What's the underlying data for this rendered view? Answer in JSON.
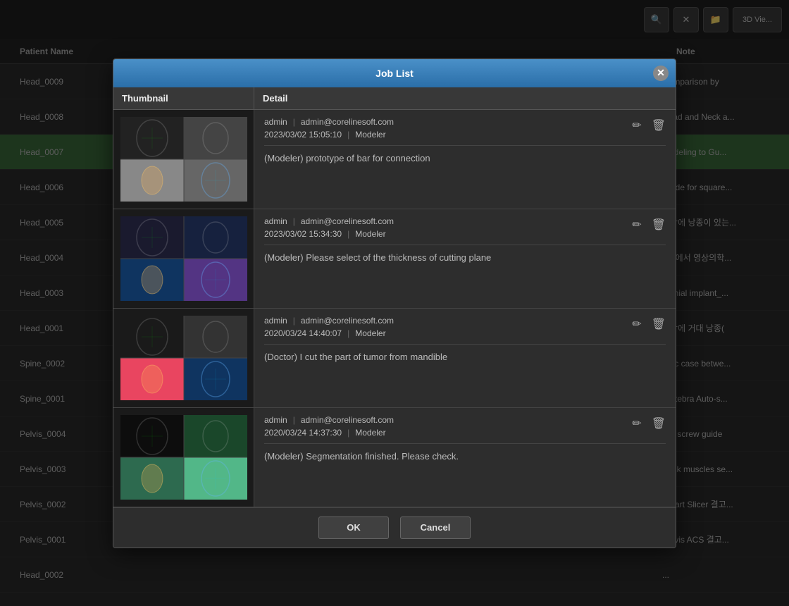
{
  "app": {
    "title": "Job List"
  },
  "toolbar": {
    "search_icon": "🔍",
    "close_icon": "✕",
    "folder_icon": "📁",
    "view_label": "3D Vie..."
  },
  "table": {
    "col_patient": "Patient Name",
    "col_note": "Note",
    "rows": [
      {
        "id": "row-head-0009",
        "patient": "Head_0009",
        "note": "Comparison by",
        "selected": false
      },
      {
        "id": "row-head-0008",
        "patient": "Head_0008",
        "note": "Head and Neck a...",
        "selected": false
      },
      {
        "id": "row-head-0007",
        "patient": "Head_0007",
        "note": "Modeling to Gu...",
        "selected": true
      },
      {
        "id": "row-head-0006",
        "patient": "Head_0006",
        "note": "Guide for square...",
        "selected": false
      },
      {
        "id": "row-head-0005",
        "patient": "Head_0005",
        "note": "상악에 낭종이 있는...",
        "selected": false
      },
      {
        "id": "row-head-0004",
        "patient": "Head_0004",
        "note": "MR에서 영상의학...",
        "selected": false
      },
      {
        "id": "row-head-0003",
        "patient": "Head_0003",
        "note": "cranial implant_...",
        "selected": false
      },
      {
        "id": "row-head-0001",
        "patient": "Head_0001",
        "note": "하악에 거대 낭종(",
        "selected": false
      },
      {
        "id": "row-spine-0002",
        "patient": "Spine_0002",
        "note": "Disc case betwe...",
        "selected": false
      },
      {
        "id": "row-spine-0001",
        "patient": "Spine_0001",
        "note": "Vertebra Auto-s...",
        "selected": false
      },
      {
        "id": "row-pelvis-0004",
        "patient": "Pelvis_0004",
        "note": "Hip screw guide",
        "selected": false
      },
      {
        "id": "row-pelvis-0003",
        "patient": "Pelvis_0003",
        "note": "Back muscles se...",
        "selected": false
      },
      {
        "id": "row-pelvis-0002",
        "patient": "Pelvis_0002",
        "note": "Smart Slicer 결고...",
        "selected": false
      },
      {
        "id": "row-pelvis-0001",
        "patient": "Pelvis_0001",
        "note": "Pelvis ACS 결고...",
        "selected": false
      },
      {
        "id": "row-head-0002",
        "patient": "Head_0002",
        "note": "...",
        "selected": false
      }
    ]
  },
  "modal": {
    "title": "Job List",
    "col_thumbnail": "Thumbnail",
    "col_detail": "Detail",
    "jobs": [
      {
        "id": "job-1",
        "user": "admin",
        "email": "admin@corelinesoft.com",
        "datetime": "2023/03/02 15:05:10",
        "role": "Modeler",
        "message": "(Modeler) prototype of bar for connection",
        "has_actions": true
      },
      {
        "id": "job-2",
        "user": "admin",
        "email": "admin@corelinesoft.com",
        "datetime": "2023/03/02 15:34:30",
        "role": "Modeler",
        "message": "(Modeler) Please select of the thickness of cutting plane",
        "has_actions": true
      },
      {
        "id": "job-3",
        "user": "admin",
        "email": "admin@corelinesoft.com",
        "datetime": "2020/03/24 14:40:07",
        "role": "Modeler",
        "message": "(Doctor) I cut the part of tumor from mandible",
        "has_actions": true
      },
      {
        "id": "job-4",
        "user": "admin",
        "email": "admin@corelinesoft.com",
        "datetime": "2020/03/24 14:37:30",
        "role": "Modeler",
        "message": "(Modeler) Segmentation finished. Please check.",
        "has_actions": true
      }
    ],
    "buttons": {
      "ok": "OK",
      "cancel": "Cancel"
    }
  }
}
